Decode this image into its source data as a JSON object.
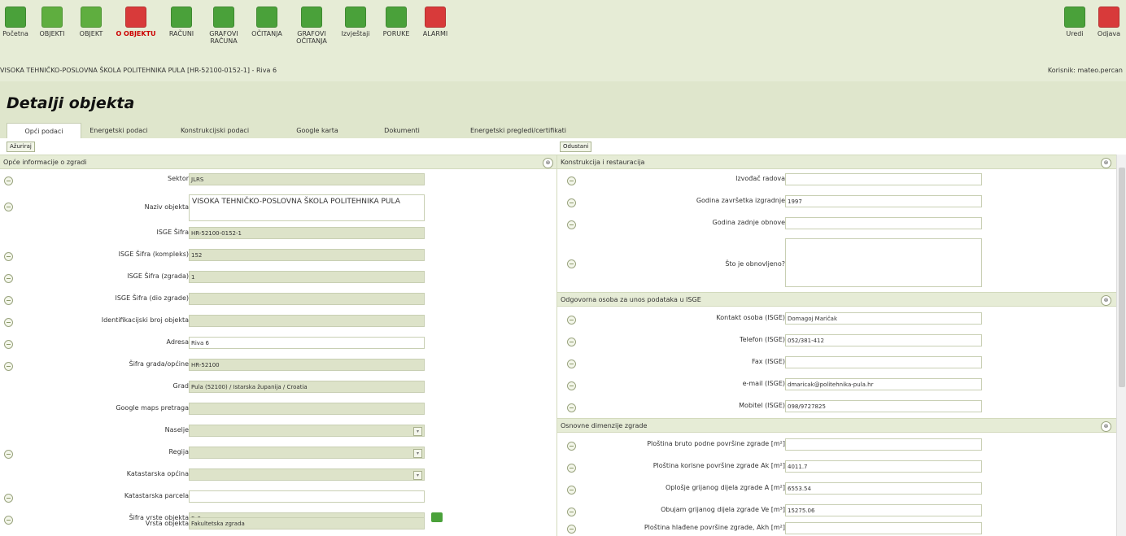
{
  "nav": [
    {
      "label": "Početna",
      "icon": "home-icon",
      "color": "#4aa13a"
    },
    {
      "label": "OBJEKTI",
      "icon": "objects-icon",
      "color": "#5fae3f"
    },
    {
      "label": "OBJEKT",
      "icon": "object-icon",
      "color": "#5fae3f"
    },
    {
      "label": "O OBJEKTU",
      "icon": "globe-icon",
      "color": "#d83a3a"
    },
    {
      "label": "RAČUNI",
      "icon": "bills-icon",
      "color": "#4aa13a"
    },
    {
      "label": "GRAFOVI RAČUNA",
      "icon": "bill-chart-icon",
      "color": "#4aa13a"
    },
    {
      "label": "OČITANJA",
      "icon": "readings-icon",
      "color": "#4aa13a"
    },
    {
      "label": "GRAFOVI OČITANJA",
      "icon": "readings-chart-icon",
      "color": "#4aa13a"
    },
    {
      "label": "Izvještaji",
      "icon": "reports-icon",
      "color": "#4aa13a"
    },
    {
      "label": "PORUKE",
      "icon": "messages-icon",
      "color": "#4aa13a"
    },
    {
      "label": "ALARMI",
      "icon": "alarms-icon",
      "color": "#d83a3a"
    },
    {
      "label": "Uredi",
      "icon": "edit-icon",
      "color": "#4aa13a"
    },
    {
      "label": "Odjava",
      "icon": "logout-icon",
      "color": "#d83a3a"
    }
  ],
  "breadcrumb": "VISOKA TEHNIČKO-POSLOVNA ŠKOLA POLITEHNIKA PULA [HR-52100-0152-1] - Riva 6",
  "user": "Korisnik: mateo.percan",
  "page_title": "Detalji objekta",
  "tabs": [
    "Opći podaci",
    "Energetski podaci",
    "Konstrukcijski podaci",
    "Google karta",
    "Dokumenti",
    "Energetski pregledi/certifikati"
  ],
  "buttons": {
    "left": "Ažuriraj",
    "right": "Odustani"
  },
  "left_panel": {
    "title": "Opće informacije o zgradi",
    "collapse": "⊗",
    "rows": [
      {
        "label": "Sektor",
        "value": "JLRS"
      },
      {
        "label": "Naziv objekta",
        "value": "VISOKA TEHNIČKO-POSLOVNA ŠKOLA POLITEHNIKA PULA"
      },
      {
        "label": "ISGE Šifra",
        "value": "HR-52100-0152-1"
      },
      {
        "label": "ISGE Šifra (kompleks)",
        "value": "152"
      },
      {
        "label": "ISGE Šifra (zgrada)",
        "value": "1"
      },
      {
        "label": "ISGE Šifra (dio zgrade)",
        "value": ""
      },
      {
        "label": "Identifikacijski broj objekta",
        "value": ""
      },
      {
        "label": "Adresa",
        "value": "Riva 6"
      },
      {
        "label": "Šifra grada/općine",
        "value": "HR-52100"
      },
      {
        "label": "Grad",
        "value": "Pula (52100) / Istarska županija / Croatia"
      },
      {
        "label": "Google maps pretraga",
        "value": ""
      },
      {
        "label": "Naselje",
        "value": ""
      },
      {
        "label": "Regija",
        "value": ""
      },
      {
        "label": "Katastarska općina",
        "value": ""
      },
      {
        "label": "Katastarska parcela",
        "value": ""
      },
      {
        "label": "Šifra vrste objekta",
        "value": "Fa2"
      },
      {
        "label": "Vrsta objekta",
        "value": "Fakultetska zgrada"
      }
    ]
  },
  "right_sections": [
    {
      "title": "Konstrukcija i restauracija",
      "collapse": "⊗",
      "rows": [
        {
          "label": "Izvođač radova",
          "value": ""
        },
        {
          "label": "Godina završetka izgradnje",
          "value": "1997"
        },
        {
          "label": "Godina zadnje obnove",
          "value": ""
        },
        {
          "label": "Što je obnovljeno?",
          "value": ""
        }
      ]
    },
    {
      "title": "Odgovorna osoba za unos podataka u ISGE",
      "collapse": "⊗",
      "rows": [
        {
          "label": "Kontakt osoba (ISGE)",
          "value": "Domagoj Maričak"
        },
        {
          "label": "Telefon (ISGE)",
          "value": "052/381-412"
        },
        {
          "label": "Fax (ISGE)",
          "value": ""
        },
        {
          "label": "e-mail (ISGE)",
          "value": "dmaricak@politehnika-pula.hr"
        },
        {
          "label": "Mobitel (ISGE)",
          "value": "098/9727825"
        }
      ]
    },
    {
      "title": "Osnovne dimenzije zgrade",
      "collapse": "⊗",
      "rows": [
        {
          "label": "Ploština bruto podne površine zgrade [m²]",
          "value": ""
        },
        {
          "label": "Ploština korisne površine zgrade Ak [m²]",
          "value": "4011.7"
        },
        {
          "label": "Oplošje grijanog dijela zgrade A [m²]",
          "value": "6553.54"
        },
        {
          "label": "Obujam grijanog dijela zgrade Ve [m³]",
          "value": "15275.06"
        },
        {
          "label": "Ploština hlađene površine zgrade, Akh [m²]",
          "value": ""
        }
      ]
    }
  ]
}
